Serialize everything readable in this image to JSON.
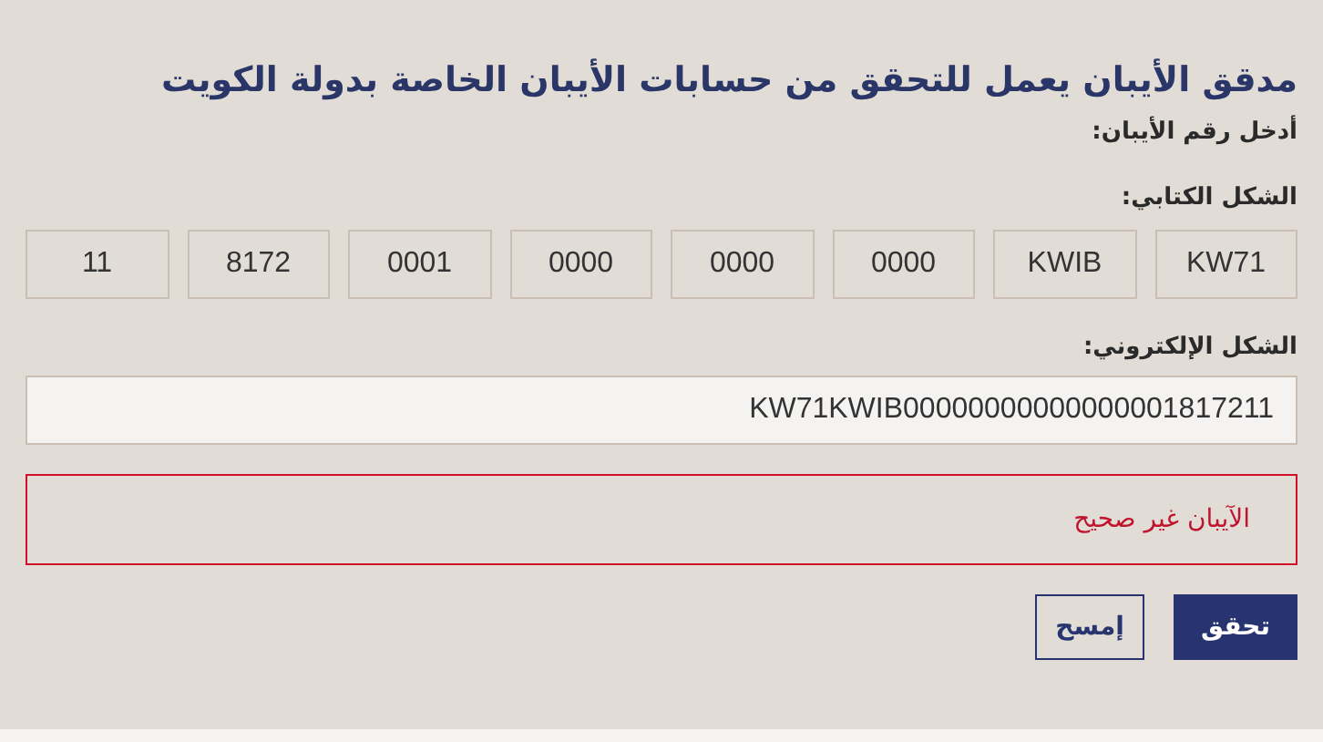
{
  "title": "مدقق الأيبان يعمل للتحقق من حسابات الأيبان الخاصة بدولة الكويت",
  "prompt": "أدخل رقم الأيبان:",
  "written_form": {
    "label": "الشكل الكتابي:",
    "groups": [
      "KW71",
      "KWIB",
      "0000",
      "0000",
      "0000",
      "0001",
      "8172",
      "11"
    ]
  },
  "electronic_form": {
    "label": "الشكل الإلكتروني:",
    "value": "KW71KWIB00000000000000001817211"
  },
  "error_message": "الآيبان غير صحيح",
  "buttons": [
    {
      "kind": "primary",
      "label": "تحقق"
    },
    {
      "kind": "secondary",
      "label": "إمسح"
    }
  ]
}
